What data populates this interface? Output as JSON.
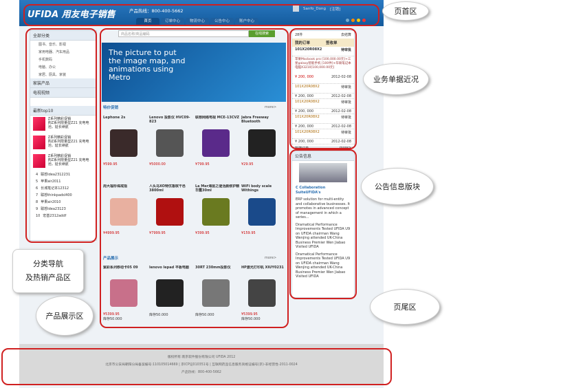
{
  "header": {
    "logo": "UFIDA 用友电子销售",
    "hotline": "产品热线：800-400-5662",
    "username": "Sanfo_Dong",
    "logout": "[注销]",
    "nav": [
      "首页",
      "订单中心",
      "物流中心",
      "公告中心",
      "账户中心"
    ]
  },
  "search": {
    "placeholder": "商品名称/商品编码",
    "button": "在线搜索"
  },
  "sidebar": {
    "header": "全部分类",
    "cats": [
      "图书、音乐、影视",
      "家用电器、汽车用品",
      "手机数码",
      "电脑、办公",
      "家居、厨具、家装"
    ],
    "sec2": "家装产品",
    "sec3": "电视视频",
    "top_header": "最新top10",
    "hot": [
      {
        "n": "1",
        "t": "Z系列精彩促销",
        "d": "购Z系列限量型Z21 充电电池，延长续航"
      },
      {
        "n": "2",
        "t": "Z系列精彩促销",
        "d": "购Z系列限量型Z21 充电电池，延长续航"
      },
      {
        "n": "3",
        "t": "Z系列精彩促销",
        "d": "购Z系列限量型Z21 充电电池，延长续航"
      }
    ],
    "ranks": [
      {
        "n": "4",
        "t": "联想idea2312231"
      },
      {
        "n": "5",
        "t": "苹果air2011"
      },
      {
        "n": "6",
        "t": "长城笔记本12312"
      },
      {
        "n": "7",
        "t": "联想thinkpadsl400"
      },
      {
        "n": "8",
        "t": "苹果air2010"
      },
      {
        "n": "9",
        "t": "联想idea23123"
      },
      {
        "n": "10",
        "t": "宏基2312addf"
      }
    ]
  },
  "banner": {
    "text": "The picture to put the image map, and animations using Metro"
  },
  "promo": {
    "title": "特价促销",
    "more": "more>",
    "items": [
      {
        "name": "Lephone 2s",
        "price": "¥599.95",
        "color": "#3a2a2a"
      },
      {
        "name": "Lenovo 投影仪 HVC09-823",
        "price": "¥5000.00",
        "color": "#555"
      },
      {
        "name": "联想网络电视 MCE-13CVZ",
        "price": "¥799.95",
        "color": "#5a2a8a"
      },
      {
        "name": "Jabra Freeway Bluetooth Speakerphone",
        "price": "¥29.95",
        "color": "#222"
      },
      {
        "name": "周大福珍珠戒指",
        "price": "¥4999.95",
        "color": "#e8b0a0"
      },
      {
        "name": "人头马XO特优香槟干邑 3800ml",
        "price": "¥7999.95",
        "color": "#b01010"
      },
      {
        "name": "La Mer海蓝之谜活颜修护精华露30ml",
        "price": "¥399.95",
        "color": "#6a7a20"
      },
      {
        "name": "WiFi body scale Withings",
        "price": "¥159.95",
        "color": "#1a4a8a"
      }
    ]
  },
  "newp": {
    "title": "产品展示",
    "more": "more>",
    "items": [
      {
        "name": "紫彩系列移动卡05 09",
        "price": "¥5399.95",
        "color": "#c8708a"
      },
      {
        "name": "lenovo lepad 平板电脑",
        "price": "",
        "color": "#222"
      },
      {
        "name": "30RT 230mm投影仪",
        "price": "",
        "color": "#777"
      },
      {
        "name": "HP激光打印机 XIUY0231",
        "price": "¥5399.95",
        "color": "#444"
      }
    ],
    "stock": "库存50.000"
  },
  "orders": {
    "cart": "28件",
    "settle": "去结算",
    "tab1": "我的订单",
    "tab2": "签收单",
    "col1": "101X20R08X2",
    "col2": "待审批",
    "desc": "苹果Macbook pro [100,000.00元]+三星galaxy智能手机 [100件]+华硕笔记本电脑X3210[100,000.00元]",
    "first_price": "¥ 200, 000",
    "first_date": "2012-02-08",
    "rows": [
      {
        "id": "101X20R08X2",
        "st": "待审批",
        "price": "¥ 200, 000",
        "date": "2012-02-08"
      },
      {
        "id": "101X20R08X2",
        "st": "待审批",
        "price": "¥ 200, 000",
        "date": "2012-02-08"
      },
      {
        "id": "101X20R08X2",
        "st": "待审批",
        "price": "¥ 200, 000",
        "date": "2012-02-08"
      },
      {
        "id": "101X20R08X2",
        "st": "待审批",
        "price": "¥ 200, 000",
        "date": "2012-02-08"
      }
    ],
    "new_order": "新建订单",
    "more": "more>"
  },
  "notice": {
    "title": "公告信息",
    "headline": "C Collaboration SuiteUFIDA's",
    "body": "ERP solution for multi-entity and collaborative businesses. It promotes in advanced concept of management in which a series...",
    "items": [
      "Dramatical Performance Improvements Tested UFIDA U9 on UFIDA chairman Wang Wenjing attended UK-China Business Premier Wen Jiabao Visited UFIDA",
      "Dramatical Performance Improvements Tested UFIDA U9 on UFIDA chairman Wang Wenjing attended UK-China Business Premier Wen Jiabao Visited UFIDA"
    ]
  },
  "footer": {
    "l1": "版权所有:南京软件股份有限公司 UFIDA 2012",
    "l2": "北京市公安局朝阳分局备案编号:110105014669  |  京ICP证010351号  |  互联网药品信息服务资格证编号(京)-非经营性-2011-0024",
    "l3": "产品热线：800-400-5662"
  },
  "callouts": {
    "header": "页首区",
    "orders": "业务单据近况",
    "notice": "公告信息版块",
    "footer": "页尾区",
    "nav": "分类导航\n及热销产品区",
    "products": "产品展示区"
  }
}
